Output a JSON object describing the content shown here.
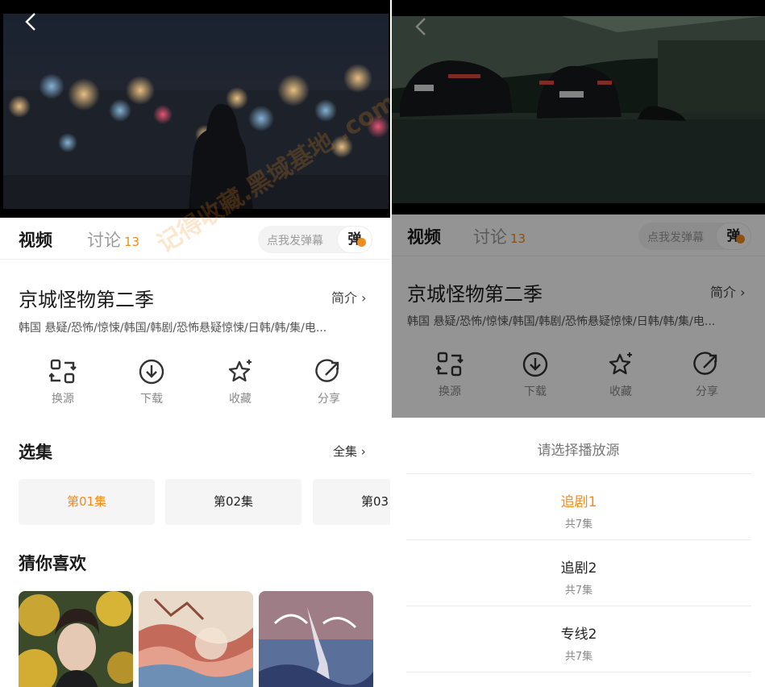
{
  "colors": {
    "accent": "#f08c1e",
    "text": "#1a1a1a",
    "muted": "#9a9a9a"
  },
  "watermark": "记得收藏.黑域基地 .com",
  "left": {
    "back_icon": "chevron-left-icon",
    "tabs": {
      "video": "视频",
      "discuss": "讨论",
      "discuss_count": "13"
    },
    "danmu": {
      "placeholder": "点我发弹幕",
      "button": "弹"
    },
    "title": "京城怪物第二季",
    "intro": "简介 ›",
    "tags": "韩国  悬疑/恐怖/惊悚/韩国/韩剧/恐怖悬疑惊悚/日韩/韩/集/电...",
    "actions": [
      {
        "icon": "switch-source-icon",
        "label": "换源"
      },
      {
        "icon": "download-icon",
        "label": "下载"
      },
      {
        "icon": "star-icon",
        "label": "收藏"
      },
      {
        "icon": "share-icon",
        "label": "分享"
      }
    ],
    "episodes_title": "选集",
    "episodes_all": "全集 ›",
    "episodes": [
      "第01集",
      "第02集",
      "第03"
    ],
    "recommend_title": "猜你喜欢"
  },
  "right": {
    "tabs": {
      "video": "视频",
      "discuss": "讨论",
      "discuss_count": "13"
    },
    "danmu": {
      "placeholder": "点我发弹幕",
      "button": "弹"
    },
    "title": "京城怪物第二季",
    "intro": "简介 ›",
    "tags": "韩国  悬疑/恐怖/惊悚/韩国/韩剧/恐怖悬疑惊悚/日韩/韩/集/电...",
    "actions": [
      {
        "icon": "switch-source-icon",
        "label": "换源"
      },
      {
        "icon": "download-icon",
        "label": "下载"
      },
      {
        "icon": "star-icon",
        "label": "收藏"
      },
      {
        "icon": "share-icon",
        "label": "分享"
      }
    ],
    "sheet": {
      "title": "请选择播放源",
      "sources": [
        {
          "name": "追剧1",
          "count": "共7集",
          "selected": true
        },
        {
          "name": "追剧2",
          "count": "共7集",
          "selected": false
        },
        {
          "name": "专线2",
          "count": "共7集",
          "selected": false
        }
      ]
    }
  }
}
